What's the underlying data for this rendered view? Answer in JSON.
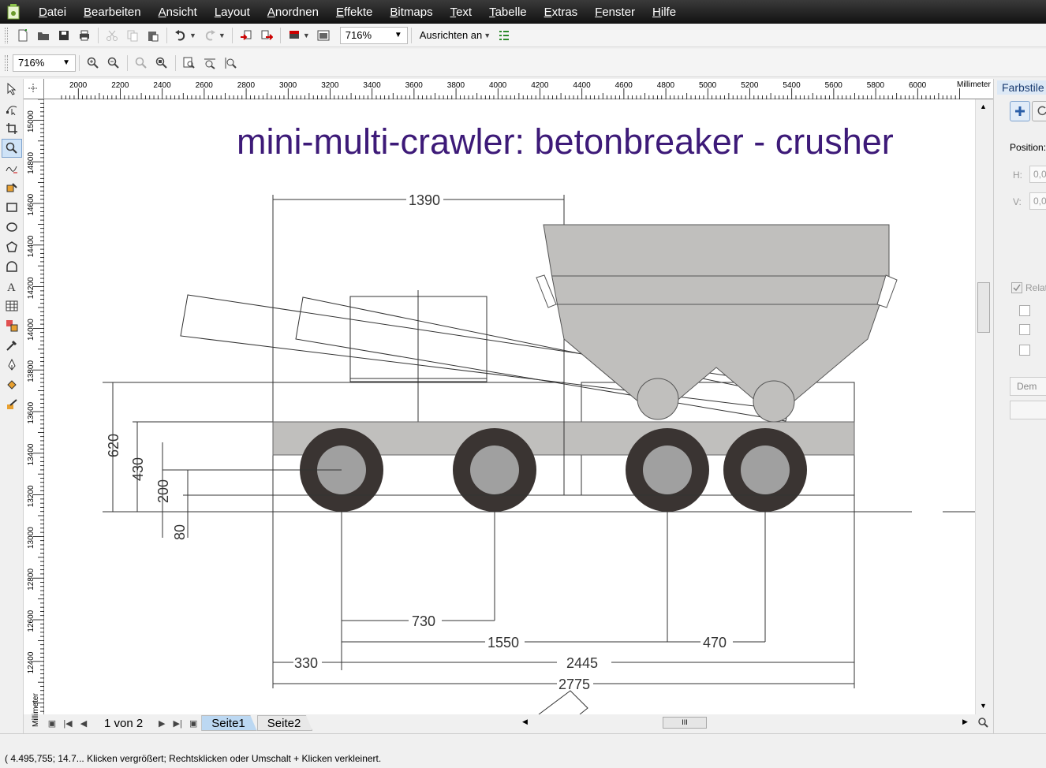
{
  "menu": [
    "Datei",
    "Bearbeiten",
    "Ansicht",
    "Layout",
    "Anordnen",
    "Effekte",
    "Bitmaps",
    "Text",
    "Tabelle",
    "Extras",
    "Fenster",
    "Hilfe"
  ],
  "toolbar": {
    "zoom_value": "716%",
    "snap_label": "Ausrichten an",
    "zoom2_value": "716%"
  },
  "ruler": {
    "h_unit": "Millimeter",
    "h_ticks": [
      "2000",
      "2200",
      "2400",
      "2600",
      "2800",
      "3000",
      "3200",
      "3400",
      "3600",
      "3800",
      "4000",
      "4200",
      "4400",
      "4600",
      "4800",
      "5000",
      "5200",
      "5400",
      "5600",
      "5800",
      "6000"
    ],
    "v_unit": "Millimeter",
    "v_ticks": [
      "15000",
      "14800",
      "14600",
      "14400",
      "14200",
      "14000",
      "13800",
      "13600",
      "13400",
      "13200",
      "13000",
      "12800",
      "12600",
      "12400"
    ]
  },
  "drawing": {
    "title": "mini-multi-crawler: betonbreaker - crusher",
    "title_color": "#3d1a78",
    "dimensions": {
      "d1390": "1390",
      "d620": "620",
      "d430": "430",
      "d200": "200",
      "d80": "80",
      "d730": "730",
      "d1550": "1550",
      "d470": "470",
      "d330": "330",
      "d2445": "2445",
      "d2775": "2775"
    }
  },
  "pages": {
    "count_text": "1 von 2",
    "tabs": [
      "Seite1",
      "Seite2"
    ]
  },
  "dock": {
    "title": "Farbstile",
    "position_label": "Position:",
    "h_label": "H:",
    "v_label": "V:",
    "h_value": "0,0",
    "v_value": "0,0",
    "relative_label": "Relat",
    "dem_label": "Dem"
  },
  "status": {
    "text": "( 4.495,755; 14.7... Klicken vergrößert; Rechtsklicken oder Umschalt + Klicken verkleinert."
  },
  "colors": {
    "menubar": "#1e1e1e",
    "wheel_tire": "#3a3432",
    "wheel_hub": "#a0a0a0",
    "body_fill": "#c0bfbd"
  }
}
